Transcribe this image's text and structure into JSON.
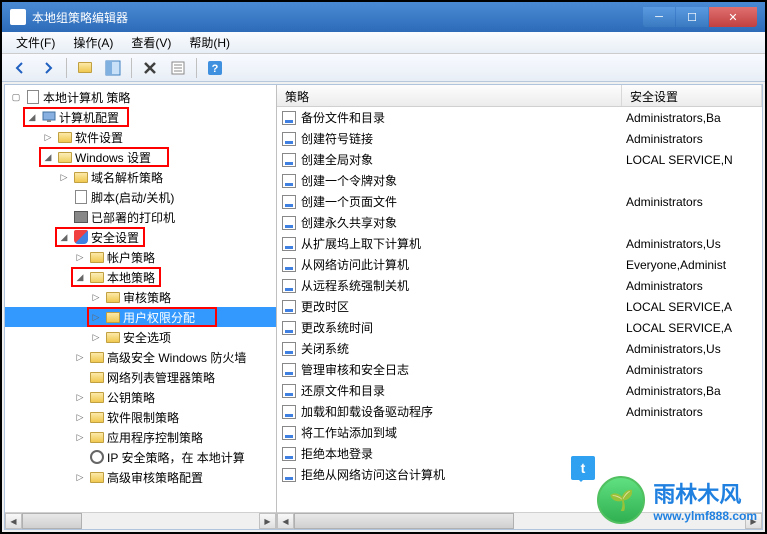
{
  "window": {
    "title": "本地组策略编辑器"
  },
  "menu": {
    "file": "文件(F)",
    "action": "操作(A)",
    "view": "查看(V)",
    "help": "帮助(H)"
  },
  "tree": {
    "root": "本地计算机 策略",
    "computer_config": "计算机配置",
    "software_settings": "软件设置",
    "windows_settings": "Windows 设置",
    "dns_policy": "域名解析策略",
    "scripts": "脚本(启动/关机)",
    "printers": "已部署的打印机",
    "security_settings": "安全设置",
    "account_policies": "帐户策略",
    "local_policies": "本地策略",
    "audit_policy": "审核策略",
    "user_rights": "用户权限分配",
    "security_options": "安全选项",
    "advanced_firewall": "高级安全 Windows 防火墙",
    "network_list": "网络列表管理器策略",
    "public_key": "公钥策略",
    "software_restriction": "软件限制策略",
    "app_control": "应用程序控制策略",
    "ip_security": "IP 安全策略，在 本地计算",
    "advanced_audit": "高级审核策略配置"
  },
  "list": {
    "col_policy": "策略",
    "col_security": "安全设置",
    "rows": [
      {
        "name": "备份文件和目录",
        "sec": "Administrators,Ba"
      },
      {
        "name": "创建符号链接",
        "sec": "Administrators"
      },
      {
        "name": "创建全局对象",
        "sec": "LOCAL SERVICE,N"
      },
      {
        "name": "创建一个令牌对象",
        "sec": ""
      },
      {
        "name": "创建一个页面文件",
        "sec": "Administrators"
      },
      {
        "name": "创建永久共享对象",
        "sec": ""
      },
      {
        "name": "从扩展坞上取下计算机",
        "sec": "Administrators,Us"
      },
      {
        "name": "从网络访问此计算机",
        "sec": "Everyone,Administ"
      },
      {
        "name": "从远程系统强制关机",
        "sec": "Administrators"
      },
      {
        "name": "更改时区",
        "sec": "LOCAL SERVICE,A"
      },
      {
        "name": "更改系统时间",
        "sec": "LOCAL SERVICE,A"
      },
      {
        "name": "关闭系统",
        "sec": "Administrators,Us"
      },
      {
        "name": "管理审核和安全日志",
        "sec": "Administrators"
      },
      {
        "name": "还原文件和目录",
        "sec": "Administrators,Ba"
      },
      {
        "name": "加载和卸载设备驱动程序",
        "sec": "Administrators"
      },
      {
        "name": "将工作站添加到域",
        "sec": ""
      },
      {
        "name": "拒绝本地登录",
        "sec": ""
      },
      {
        "name": "拒绝从网络访问这台计算机",
        "sec": ""
      }
    ]
  },
  "watermark": {
    "main": "雨林木风",
    "url": "www.ylmf888.com",
    "flag": "t"
  }
}
